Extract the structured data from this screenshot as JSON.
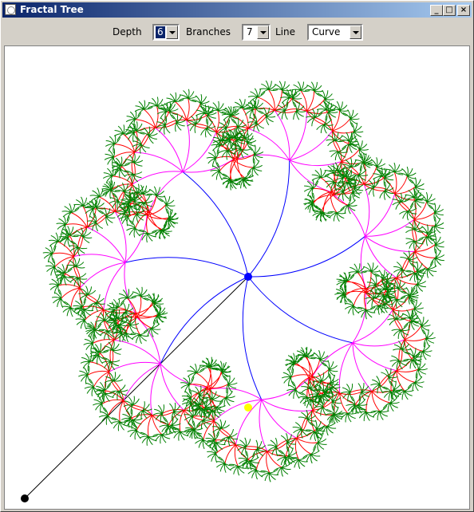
{
  "window": {
    "title": "Fractal Tree"
  },
  "toolbar": {
    "depth_label": "Depth",
    "depth_value": "6",
    "branches_label": "Branches",
    "branches_value": "7",
    "line_label": "Line",
    "line_value": "Curve"
  },
  "colors": {
    "level_colors": [
      "#000000",
      "#0000ff",
      "#ff00ff",
      "#ff0000",
      "#008000"
    ],
    "center_point": "#0000ff",
    "secondary_point": "#ffff00",
    "root_point": "#000000",
    "canvas_background": "#ffffff"
  }
}
